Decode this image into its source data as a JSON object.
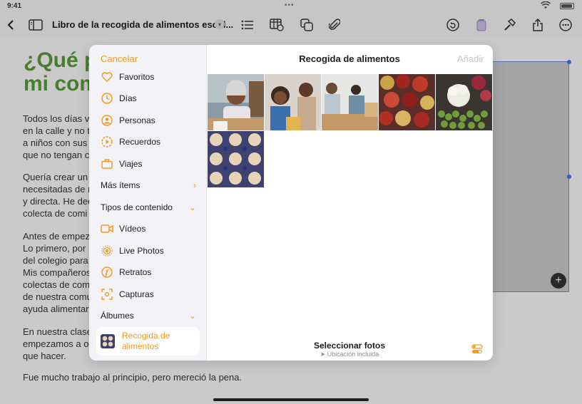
{
  "status": {
    "time": "9:41",
    "dots": "•••"
  },
  "toolbar": {
    "doc_title": "Libro de la recogida de alimentos escol..."
  },
  "document": {
    "heading_line1": "¿Qué p",
    "heading_line2": "mi com",
    "para1": [
      "Todos los días v",
      "en la calle y no t",
      "a niños con sus",
      "que no tengan c"
    ],
    "para2": [
      "Quería crear un",
      "necesitadas de n",
      "y directa. He dec",
      "colecta de comi"
    ],
    "para3": [
      "Antes de empez",
      "Lo primero, por",
      "del colegio para",
      "Mis compañeros",
      "colectas de com",
      "de nuestra comu",
      "ayuda alimentar"
    ],
    "para4": [
      "En nuestra clase",
      "empezamos a o",
      "que hacer."
    ],
    "last_line": "Fue mucho trabajo al principio, pero mereció la pena."
  },
  "picker": {
    "cancel_label": "Cancelar",
    "title": "Recogida de alimentos",
    "add_label": "Añadir",
    "sidebar_items": [
      {
        "label": "Favoritos",
        "icon": "heart-icon"
      },
      {
        "label": "Días",
        "icon": "clock-icon"
      },
      {
        "label": "Personas",
        "icon": "person-icon"
      },
      {
        "label": "Recuerdos",
        "icon": "memories-icon"
      },
      {
        "label": "Viajes",
        "icon": "suitcase-icon"
      }
    ],
    "more_items_label": "Más ítems",
    "content_types_label": "Tipos de contenido",
    "content_types": [
      {
        "label": "Vídeos",
        "icon": "video-icon"
      },
      {
        "label": "Live Photos",
        "icon": "live-photo-icon"
      },
      {
        "label": "Retratos",
        "icon": "portrait-icon"
      },
      {
        "label": "Capturas",
        "icon": "screenshot-icon"
      }
    ],
    "albums_label": "Álbumes",
    "selected_album_label": "Recogida de alimentos",
    "footer_title": "Seleccionar fotos",
    "footer_subtitle": "Ubicación incluida"
  },
  "colors": {
    "accent": "#f29a1f",
    "heading_green": "#5a9a3b"
  }
}
